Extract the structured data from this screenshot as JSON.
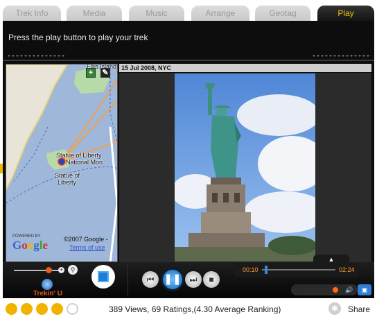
{
  "tabs": [
    {
      "label": "Trek Info"
    },
    {
      "label": "Media"
    },
    {
      "label": "Music"
    },
    {
      "label": "Arrange"
    },
    {
      "label": "Geotag"
    },
    {
      "label": "Play"
    }
  ],
  "active_tab": "Play",
  "instruction": "Press the play button to play your trek",
  "map": {
    "labels": [
      "Ellis Island",
      "Statue of Liberty",
      "National Mon",
      "Statue of",
      "Liberty"
    ],
    "powered_by": "POWERED BY",
    "google_letters": [
      "G",
      "o",
      "o",
      "g",
      "l",
      "e"
    ],
    "copyright": "©2007 Google -",
    "terms": "Terms of use"
  },
  "photo": {
    "caption": "15 Jul 2008,  NYC"
  },
  "player": {
    "time_elapsed": "00:10",
    "time_total": "02:24",
    "progress": 0.069,
    "volume": 0.75,
    "zoom_level": 0.8
  },
  "brand": "Trekin' U",
  "rating": {
    "filled": 4,
    "total": 5,
    "color_filled": "#f0b400"
  },
  "stats": "389 Views, 69 Ratings,(4.30 Average Ranking)",
  "share_label": "Share",
  "colors": {
    "accent": "#f0c000",
    "play_blue": "#1466b8",
    "time_orange": "#ff9a2e"
  }
}
